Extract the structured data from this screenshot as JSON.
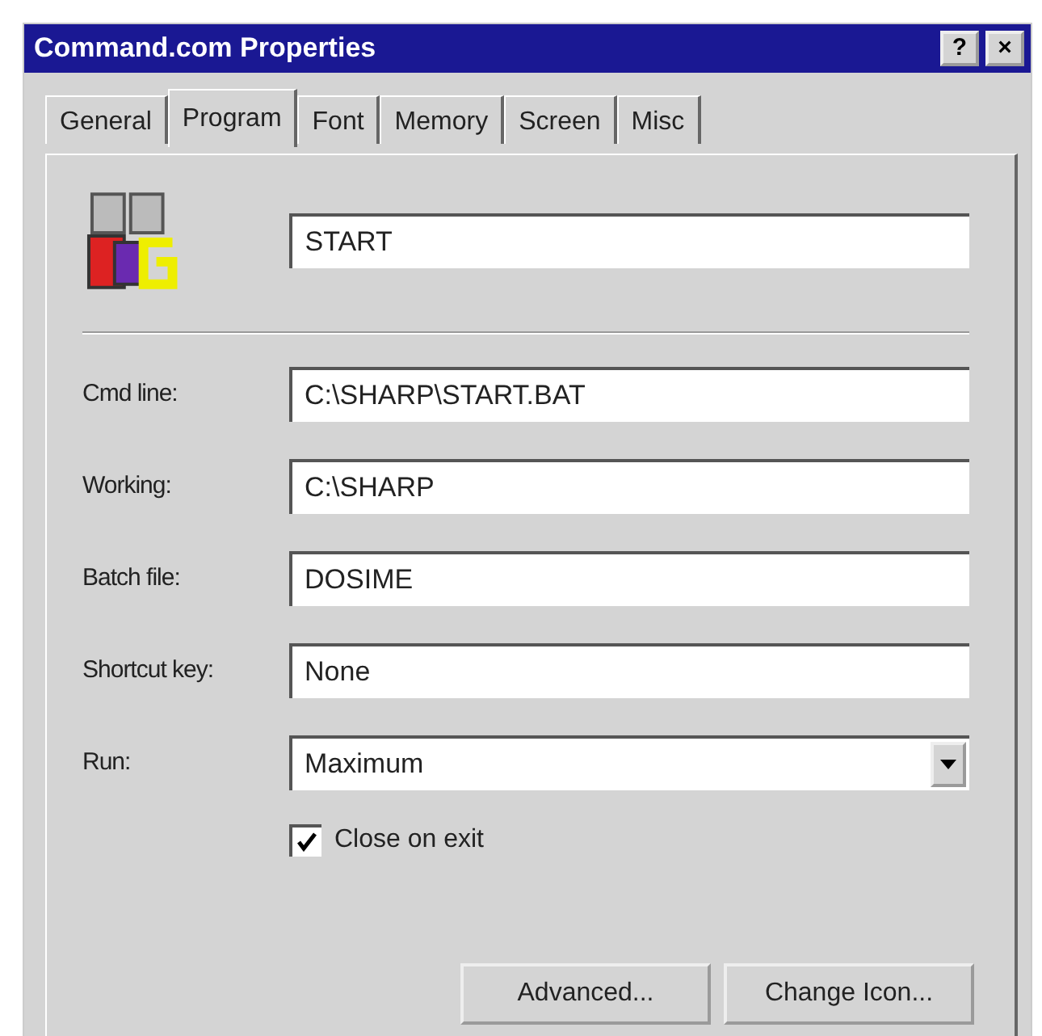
{
  "window": {
    "title": "Command.com Properties",
    "title_buttons": [
      "?",
      "×"
    ]
  },
  "tabs": [
    {
      "label": "General",
      "selected": false
    },
    {
      "label": "Program",
      "selected": true
    },
    {
      "label": "Font",
      "selected": false
    },
    {
      "label": "Memory",
      "selected": false
    },
    {
      "label": "Screen",
      "selected": false
    },
    {
      "label": "Misc",
      "selected": false
    }
  ],
  "program_name": "START",
  "fields": [
    {
      "kind": "text",
      "label": "Cmd line:",
      "value": "C:\\SHARP\\START.BAT"
    },
    {
      "kind": "text",
      "label": "Working:",
      "value": "C:\\SHARP"
    },
    {
      "kind": "text",
      "label": "Batch file:",
      "value": "DOSIME"
    },
    {
      "kind": "text",
      "label": "Shortcut key:",
      "value": "None"
    },
    {
      "kind": "dropdown",
      "label": "Run:",
      "value": "Maximum"
    }
  ],
  "close_on_exit": {
    "label": "Close on exit",
    "checked": true
  },
  "buttons": [
    "Advanced...",
    "Change Icon..."
  ]
}
